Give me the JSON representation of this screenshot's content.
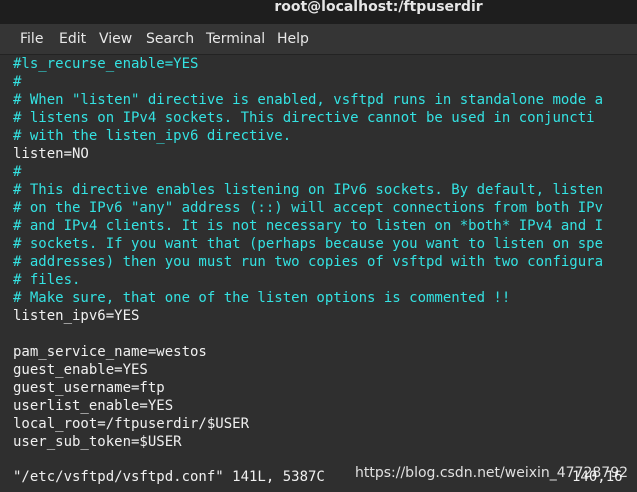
{
  "window": {
    "title": "root@localhost:/ftpuserdir"
  },
  "menu": [
    "File",
    "Edit",
    "View",
    "Search",
    "Terminal",
    "Help"
  ],
  "lines": [
    {
      "text": "#ls_recurse_enable=YES",
      "type": "comment"
    },
    {
      "text": "#",
      "type": "comment"
    },
    {
      "text": "# When \"listen\" directive is enabled, vsftpd runs in standalone mode a",
      "type": "comment"
    },
    {
      "text": "# listens on IPv4 sockets. This directive cannot be used in conjuncti",
      "type": "comment"
    },
    {
      "text": "# with the listen_ipv6 directive.",
      "type": "comment"
    },
    {
      "text": "listen=NO",
      "type": "setting"
    },
    {
      "text": "#",
      "type": "comment"
    },
    {
      "text": "# This directive enables listening on IPv6 sockets. By default, listen",
      "type": "comment"
    },
    {
      "text": "# on the IPv6 \"any\" address (::) will accept connections from both IPv",
      "type": "comment"
    },
    {
      "text": "# and IPv4 clients. It is not necessary to listen on *both* IPv4 and I",
      "type": "comment"
    },
    {
      "text": "# sockets. If you want that (perhaps because you want to listen on spe",
      "type": "comment"
    },
    {
      "text": "# addresses) then you must run two copies of vsftpd with two configura",
      "type": "comment"
    },
    {
      "text": "# files.",
      "type": "comment"
    },
    {
      "text": "# Make sure, that one of the listen options is commented !!",
      "type": "comment"
    },
    {
      "text": "listen_ipv6=YES",
      "type": "setting"
    },
    {
      "text": "",
      "type": "setting"
    },
    {
      "text": "pam_service_name=westos",
      "type": "setting"
    },
    {
      "text": "guest_enable=YES",
      "type": "setting"
    },
    {
      "text": "guest_username=ftp",
      "type": "setting"
    },
    {
      "text": "userlist_enable=YES",
      "type": "setting"
    },
    {
      "text": "local_root=/ftpuserdir/$USER",
      "type": "setting"
    },
    {
      "text": "user_sub_token=$USER",
      "type": "setting"
    }
  ],
  "status": {
    "file_info": "\"/etc/vsftpd/vsftpd.conf\" 141L, 5387C",
    "cursor": "140,16"
  },
  "watermark": "https://blog.csdn.net/weixin_47728792",
  "colors": {
    "comment": "#34e2e2",
    "setting": "#f0f0f0",
    "background": "#2f2f2f"
  }
}
